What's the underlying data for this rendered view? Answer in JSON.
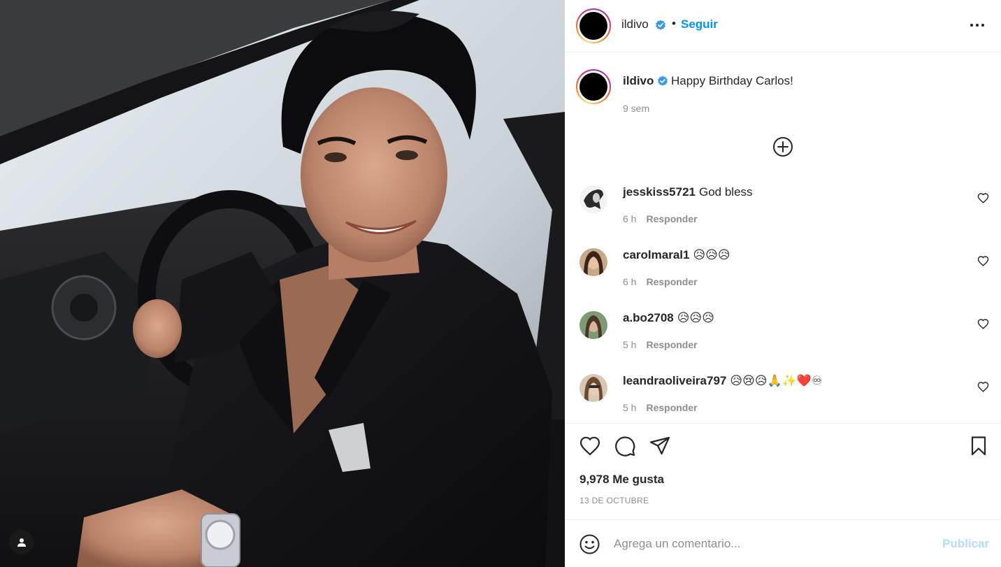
{
  "header": {
    "username": "ildivo",
    "separator": "•",
    "follow_label": "Seguir"
  },
  "caption": {
    "username": "ildivo",
    "text": "Happy Birthday Carlos!",
    "time": "9 sem"
  },
  "comments": [
    {
      "username": "jesskiss5721",
      "text": "God bless",
      "time": "6 h",
      "reply": "Responder"
    },
    {
      "username": "carolmaral1",
      "text": "😥😥😥",
      "time": "6 h",
      "reply": "Responder"
    },
    {
      "username": "a.bo2708",
      "text": "😥😥😥",
      "time": "5 h",
      "reply": "Responder"
    },
    {
      "username": "leandraoliveira797",
      "text": "😥😢😥🙏✨❤️♾",
      "time": "5 h",
      "reply": "Responder"
    }
  ],
  "stats": {
    "likes": "9,978 Me gusta",
    "date": "13 DE OCTUBRE"
  },
  "add_comment": {
    "placeholder": "Agrega un comentario...",
    "publish_label": "Publicar"
  },
  "colors": {
    "accent": "#0095f6",
    "publish_disabled": "#b3dbff",
    "muted": "#8e8e8e",
    "verified": "#3897f0"
  },
  "icons": {
    "verified": "verified-badge-icon",
    "more": "more-options-icon",
    "load_more": "plus-circle-icon",
    "like": "heart-icon",
    "comment": "comment-bubble-icon",
    "share": "paper-plane-icon",
    "save": "bookmark-icon",
    "emoji": "smiley-icon",
    "tag": "user-tag-icon"
  }
}
